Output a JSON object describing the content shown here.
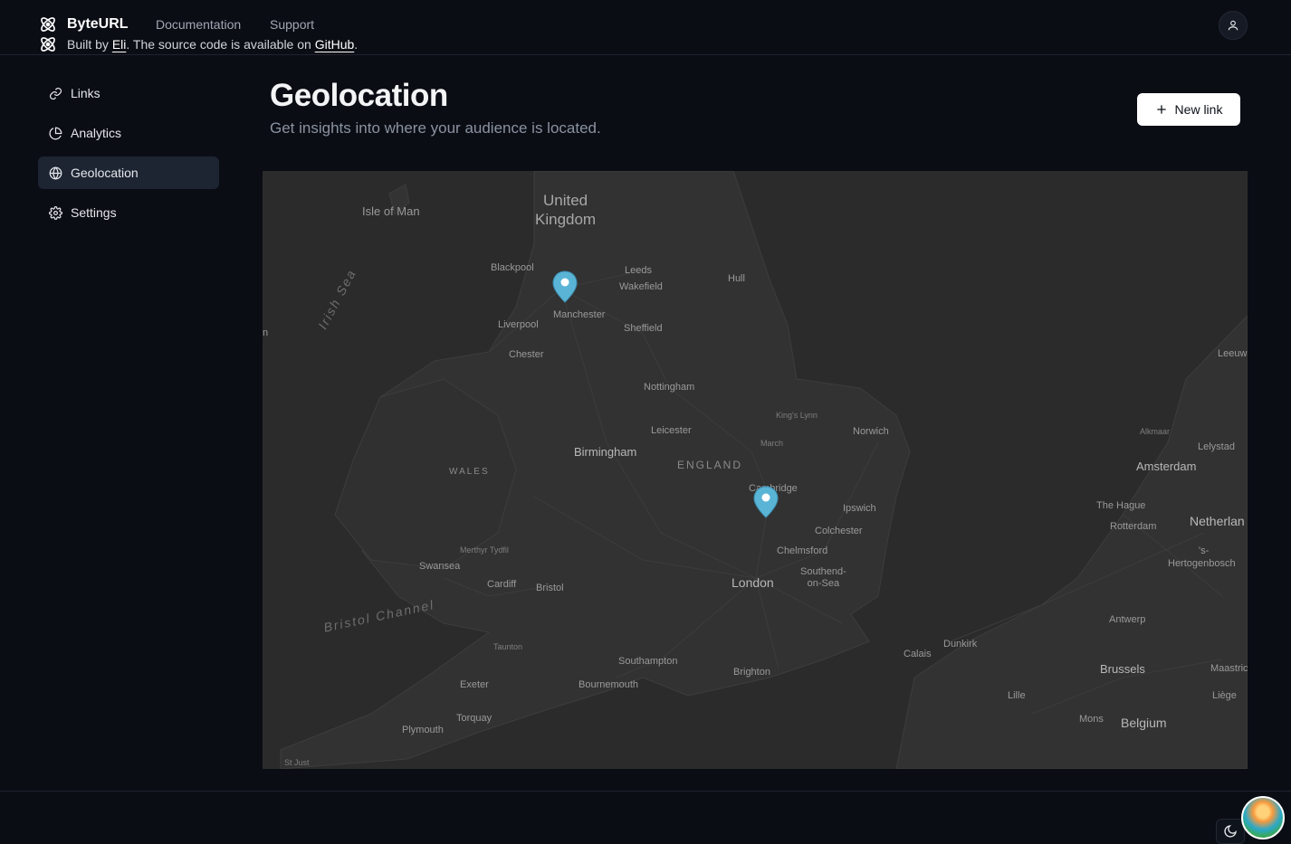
{
  "header": {
    "brand": "ByteURL",
    "nav": [
      "Documentation",
      "Support"
    ]
  },
  "sidebar": {
    "items": [
      {
        "label": "Links",
        "icon": "link-icon"
      },
      {
        "label": "Analytics",
        "icon": "pie-chart-icon"
      },
      {
        "label": "Geolocation",
        "icon": "globe-icon",
        "active": true
      },
      {
        "label": "Settings",
        "icon": "gear-icon"
      }
    ]
  },
  "main": {
    "title": "Geolocation",
    "subtitle": "Get insights into where your audience is located.",
    "new_link_label": "New link"
  },
  "map": {
    "labels": {
      "united_kingdom_1": "United",
      "united_kingdom_2": "Kingdom",
      "isle_of_man": "Isle of Man",
      "blackpool": "Blackpool",
      "leeds": "Leeds",
      "wakefield": "Wakefield",
      "hull": "Hull",
      "manchester": "Manchester",
      "liverpool": "Liverpool",
      "sheffield": "Sheffield",
      "chester": "Chester",
      "irish_sea": "Irish Sea",
      "nottingham": "Nottingham",
      "kings_lynn": "King's Lynn",
      "norwich": "Norwich",
      "leicester": "Leicester",
      "march": "March",
      "birmingham": "Birmingham",
      "england": "ENGLAND",
      "wales": "WALES",
      "cambridge": "Cambridge",
      "ipswich": "Ipswich",
      "colchester": "Colchester",
      "merthyr": "Merthyr Tydfil",
      "chelmsford": "Chelmsford",
      "swansea": "Swansea",
      "cardiff": "Cardiff",
      "bristol": "Bristol",
      "london": "London",
      "southend_1": "Southend-",
      "southend_2": "on-Sea",
      "bristol_channel": "Bristol Channel",
      "taunton": "Taunton",
      "southampton": "Southampton",
      "brighton": "Brighton",
      "exeter": "Exeter",
      "bournemouth": "Bournemouth",
      "torquay": "Torquay",
      "plymouth": "Plymouth",
      "st_just": "St Just",
      "calais": "Calais",
      "dunkirk": "Dunkirk",
      "lille": "Lille",
      "mons": "Mons",
      "brussels": "Brussels",
      "belgium": "Belgium",
      "antwerp": "Antwerp",
      "liege": "Liège",
      "maastricht": "Maastric",
      "hertogenbosch_1": "'s-",
      "hertogenbosch_2": "Hertogenbosch",
      "rotterdam": "Rotterdam",
      "the_hague": "The Hague",
      "netherlands": "Netherlan",
      "amsterdam": "Amsterdam",
      "alkmaar": "Alkmaar",
      "lelystad": "Lelystad",
      "leeuwarden": "Leeuwa",
      "edge_n": "n"
    },
    "markers": [
      {
        "name": "manchester-marker",
        "color": "#5ab4d6"
      },
      {
        "name": "cambridge-marker",
        "color": "#5ab4d6"
      }
    ]
  },
  "footer": {
    "prefix": "Built by",
    "author": "Eli",
    "middle": ". The source code is available on",
    "repo": "GitHub",
    "suffix": "."
  },
  "colors": {
    "background": "#0a0d14",
    "map_bg": "#2a2a2a",
    "marker": "#5ab4d6",
    "active_nav": "#1d2432"
  }
}
